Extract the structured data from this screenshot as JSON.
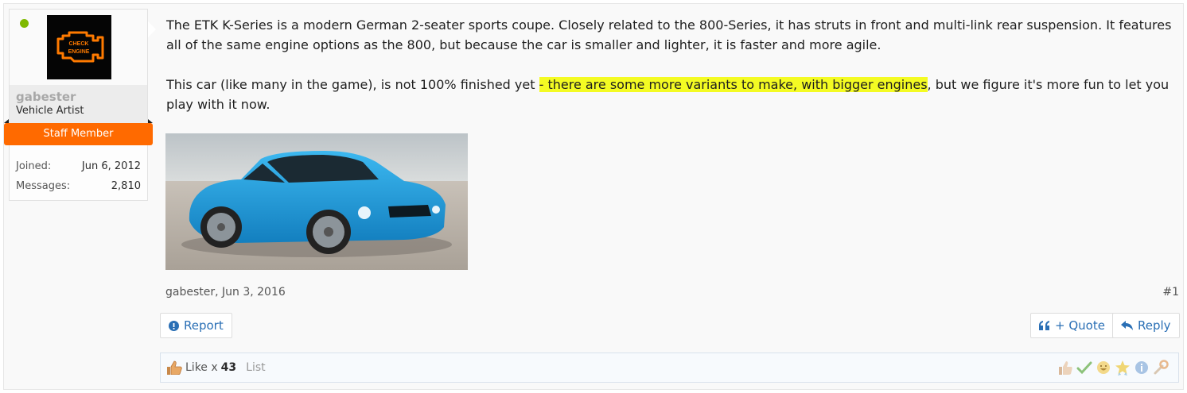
{
  "user": {
    "name": "gabester",
    "title": "Vehicle Artist",
    "banner": "Staff Member",
    "avatar_text_line1": "CHECK",
    "avatar_text_line2": "ENGINE",
    "stats": [
      {
        "label": "Joined:",
        "value": "Jun 6, 2012"
      },
      {
        "label": "Messages:",
        "value": "2,810"
      }
    ]
  },
  "message": {
    "p1": "The ETK K-Series is a modern German 2-seater sports coupe. Closely related to the 800-Series, it has struts in front and multi-link rear suspension. It features all of the same engine options as the 800, but because the car is smaller and lighter, it is faster and more agile.",
    "p2_before": "This car (like many in the game), is not 100% finished yet ",
    "p2_highlight": "- there are some more variants to make, with bigger engines",
    "p2_after": ", but we figure it's more fun to let you play with it now."
  },
  "meta": {
    "author_date": "gabester, Jun 3, 2016",
    "post_number": "#1"
  },
  "actions": {
    "report": "Report",
    "quote": "+ Quote",
    "reply": "Reply"
  },
  "likes": {
    "label": "Like x",
    "count": "43",
    "list": "List"
  },
  "colors": {
    "staff_banner": "#ff6a00",
    "online": "#7fb900",
    "highlight": "#f4fb23",
    "link": "#2a6fb5",
    "car_blue": "#1fa3e0"
  },
  "icons": [
    "check-engine-icon",
    "report-icon",
    "quote-icon",
    "reply-icon",
    "thumbs-up-icon",
    "react-like-icon",
    "react-agree-icon",
    "react-funny-icon",
    "react-winner-icon",
    "react-informative-icon",
    "react-useful-icon"
  ]
}
